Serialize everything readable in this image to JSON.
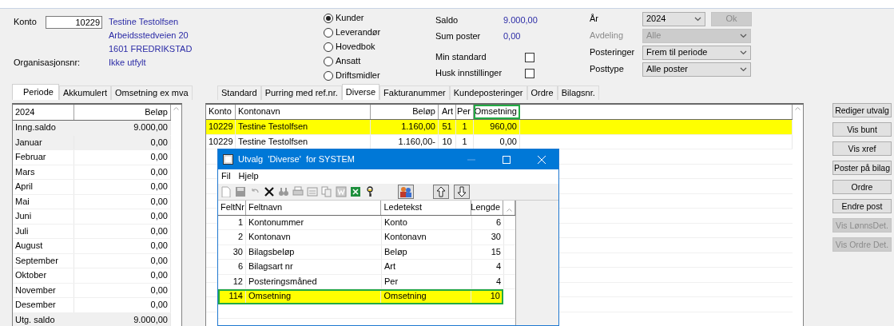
{
  "account": {
    "label": "Konto",
    "number": "10229",
    "name": "Testine Testolfsen",
    "address": "Arbeidsstedveien 20",
    "city": "1601 FREDRIKSTAD",
    "org_label": "Organisasjonsnr:",
    "org_value": "Ikke utfylt"
  },
  "ledger_types": [
    {
      "label": "Kunder",
      "selected": true
    },
    {
      "label": "Leverandør",
      "selected": false
    },
    {
      "label": "Hovedbok",
      "selected": false
    },
    {
      "label": "Ansatt",
      "selected": false
    },
    {
      "label": "Driftsmidler",
      "selected": false
    }
  ],
  "summary": {
    "saldo_label": "Saldo",
    "saldo_value": "9.000,00",
    "sum_label": "Sum poster",
    "sum_value": "0,00"
  },
  "options": [
    {
      "label": "Min standard",
      "checked": false
    },
    {
      "label": "Husk innstillinger",
      "checked": false
    }
  ],
  "filters": [
    {
      "label": "År",
      "value": "2024",
      "disabled": false
    },
    {
      "label": "Avdeling",
      "value": "Alle",
      "disabled": true
    },
    {
      "label": "Posteringer",
      "value": "Frem til periode",
      "disabled": false
    },
    {
      "label": "Posttype",
      "value": "Alle poster",
      "disabled": false
    }
  ],
  "ok_button": {
    "label": "Ok",
    "disabled": true
  },
  "period_tabs": [
    {
      "label": "Periode",
      "selected": true
    },
    {
      "label": "Akkumulert",
      "selected": false
    },
    {
      "label": "Omsetning ex mva",
      "selected": false
    }
  ],
  "period_table": {
    "columns": [
      "2024",
      "Beløp"
    ],
    "rows": [
      {
        "label": "Inng.saldo",
        "value": "9.000,00",
        "kind": "total"
      },
      {
        "label": "Januar",
        "value": "0,00",
        "kind": "current"
      },
      {
        "label": "Februar",
        "value": "0,00",
        "kind": "month"
      },
      {
        "label": "Mars",
        "value": "0,00",
        "kind": "month"
      },
      {
        "label": "April",
        "value": "0,00",
        "kind": "month"
      },
      {
        "label": "Mai",
        "value": "0,00",
        "kind": "month"
      },
      {
        "label": "Juni",
        "value": "0,00",
        "kind": "month"
      },
      {
        "label": "Juli",
        "value": "0,00",
        "kind": "month"
      },
      {
        "label": "August",
        "value": "0,00",
        "kind": "month"
      },
      {
        "label": "September",
        "value": "0,00",
        "kind": "month"
      },
      {
        "label": "Oktober",
        "value": "0,00",
        "kind": "month"
      },
      {
        "label": "November",
        "value": "0,00",
        "kind": "month"
      },
      {
        "label": "Desember",
        "value": "0,00",
        "kind": "month"
      },
      {
        "label": "Utg. saldo",
        "value": "9.000,00",
        "kind": "total"
      }
    ]
  },
  "view_tabs": [
    {
      "label": "Standard",
      "selected": false
    },
    {
      "label": "Purring med ref.nr.",
      "selected": false
    },
    {
      "label": "Diverse",
      "selected": true
    },
    {
      "label": "Fakturanummer",
      "selected": false
    },
    {
      "label": "Kundeposteringer",
      "selected": false
    },
    {
      "label": "Ordre",
      "selected": false
    },
    {
      "label": "Bilagsnr.",
      "selected": false
    }
  ],
  "postings": {
    "columns": [
      {
        "label": "Konto",
        "highlighted": false
      },
      {
        "label": "Kontonavn",
        "highlighted": false
      },
      {
        "label": "Beløp",
        "highlighted": false
      },
      {
        "label": "Art",
        "highlighted": false
      },
      {
        "label": "Per",
        "highlighted": false
      },
      {
        "label": "Omsetning",
        "highlighted": true
      }
    ],
    "rows": [
      {
        "cells": [
          "10229",
          "Testine Testolfsen",
          "1.160,00",
          "51",
          "1",
          "960,00"
        ],
        "selected": true
      },
      {
        "cells": [
          "10229",
          "Testine Testolfsen",
          "1.160,00-",
          "10",
          "1",
          "0,00"
        ],
        "selected": false
      }
    ]
  },
  "side_buttons": [
    {
      "label": "Rediger utvalg",
      "disabled": false
    },
    {
      "label": "Vis bunt",
      "disabled": false
    },
    {
      "label": "Vis xref",
      "disabled": false
    },
    {
      "label": "Poster på bilag",
      "disabled": false
    },
    {
      "label": "Ordre",
      "disabled": false
    },
    {
      "label": "Endre post",
      "disabled": false
    },
    {
      "label": "Vis LønnsDet.",
      "disabled": true
    },
    {
      "label": "Vis Ordre Det.",
      "disabled": true
    }
  ],
  "dialog": {
    "title": "Utvalg  'Diverse'  for SYSTEM",
    "menu": [
      "Fil",
      "Hjelp"
    ],
    "columns": [
      "FeltNr",
      "Feltnavn",
      "Ledetekst",
      "Lengde"
    ],
    "rows": [
      {
        "cells": [
          "1",
          "Kontonummer",
          "Konto",
          "6"
        ],
        "selected": false
      },
      {
        "cells": [
          "2",
          "Kontonavn",
          "Kontonavn",
          "30"
        ],
        "selected": false
      },
      {
        "cells": [
          "30",
          "Bilagsbeløp",
          "Beløp",
          "15"
        ],
        "selected": false
      },
      {
        "cells": [
          "6",
          "Bilagsart nr",
          "Art",
          "4"
        ],
        "selected": false
      },
      {
        "cells": [
          "12",
          "Posteringsmåned",
          "Per",
          "4"
        ],
        "selected": false
      },
      {
        "cells": [
          "114",
          "Omsetning",
          "Omsetning",
          "10"
        ],
        "selected": true
      }
    ]
  }
}
